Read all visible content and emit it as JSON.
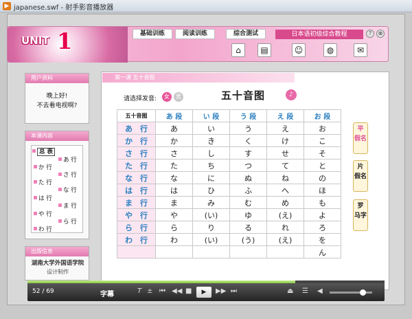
{
  "window": {
    "title": "japanese.swf - 射手影音播放器",
    "icon": "player-app-icon"
  },
  "banner": {
    "unit_label": "UNIT",
    "unit_number": "1",
    "nav_tabs": [
      "基础训练",
      "阅读训练",
      "综合测试"
    ],
    "course_title": "日本语初级综合教程",
    "circle_buttons": [
      "?",
      "⊗"
    ],
    "tool_icons": [
      "home-icon",
      "book-icon",
      "people-icon",
      "globe-icon",
      "chat-icon"
    ]
  },
  "user_panel": {
    "header": "用户资料",
    "greeting_line1": "晚上好!",
    "greeting_line2": "不去看电视啊?"
  },
  "content_panel": {
    "header": "本课内容",
    "selected": "总 表",
    "items_left": [
      "か 行",
      "た 行",
      "は 行",
      "や 行",
      "わ 行"
    ],
    "items_right": [
      "あ 行",
      "さ 行",
      "な 行",
      "ま 行",
      "ら 行"
    ]
  },
  "publisher_panel": {
    "header": "出版信息",
    "school": "湖南大学外国语学院",
    "credit": "设计制作"
  },
  "main": {
    "header": "第一课  五十音图",
    "voice_label": "请选择发音:",
    "voice_female": "女",
    "voice_male": "男",
    "title": "五十音图",
    "table": {
      "corner": "五十音图",
      "columns": [
        "あ 段",
        "い 段",
        "う 段",
        "え 段",
        "お 段"
      ],
      "rows": [
        {
          "label": "あ　行",
          "cells": [
            "あ",
            "い",
            "う",
            "え",
            "お"
          ]
        },
        {
          "label": "か　行",
          "cells": [
            "か",
            "き",
            "く",
            "け",
            "こ"
          ]
        },
        {
          "label": "さ　行",
          "cells": [
            "さ",
            "し",
            "す",
            "せ",
            "そ"
          ]
        },
        {
          "label": "た　行",
          "cells": [
            "た",
            "ち",
            "つ",
            "て",
            "と"
          ]
        },
        {
          "label": "な　行",
          "cells": [
            "な",
            "に",
            "ぬ",
            "ね",
            "の"
          ]
        },
        {
          "label": "は　行",
          "cells": [
            "は",
            "ひ",
            "ふ",
            "へ",
            "ほ"
          ]
        },
        {
          "label": "ま　行",
          "cells": [
            "ま",
            "み",
            "む",
            "め",
            "も"
          ]
        },
        {
          "label": "や　行",
          "cells": [
            "や",
            "(い)",
            "ゆ",
            "(え)",
            "よ"
          ]
        },
        {
          "label": "ら　行",
          "cells": [
            "ら",
            "り",
            "る",
            "れ",
            "ろ"
          ]
        },
        {
          "label": "わ　行",
          "cells": [
            "わ",
            "(い)",
            "(う)",
            "(え)",
            "を"
          ]
        },
        {
          "label": "",
          "cells": [
            "",
            "",
            "",
            "",
            "ん"
          ]
        }
      ]
    },
    "side_tabs": [
      {
        "line1": "平",
        "line2": "假名"
      },
      {
        "line1": "片",
        "line2": "假名"
      },
      {
        "line1": "罗",
        "line2": "马字"
      }
    ]
  },
  "player": {
    "page_count": "52 / 69",
    "subtitle_label": "字幕",
    "progress_fraction": 0.75,
    "volume_fraction": 0.78,
    "controls": [
      "T",
      "±",
      "⏮",
      "◀◀",
      "■",
      "▶▶",
      "⏭",
      "⏏",
      "☰",
      "◀"
    ],
    "play_symbol": "▶"
  }
}
